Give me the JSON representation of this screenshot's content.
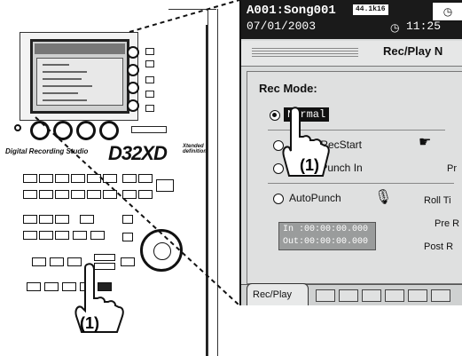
{
  "device": {
    "brand_small": "Digital Recording Studio",
    "brand_model": "D32XD",
    "brand_xtended_line1": "Xtended",
    "brand_xtended_line2": "definition"
  },
  "lcd": {
    "song_name": "A001:Song001",
    "sample_rate": "44.1k16",
    "date": "07/01/2003",
    "time": "11:25",
    "page_title": "Rec/Play N",
    "rec_mode_label": "Rec Mode:",
    "options": [
      {
        "label": "Normal",
        "selected": true
      },
      {
        "label": "/RecStart",
        "selected": false
      },
      {
        "label": "/Punch In",
        "selected": false
      },
      {
        "label": "AutoPunch",
        "selected": false
      }
    ],
    "punch_in": "In :00:00:00.000",
    "punch_out": "Out:00:00:00.000",
    "right_labels": [
      "Pr",
      "Roll Ti",
      "Pre R",
      "Post R"
    ],
    "tab_label": "Rec/Play"
  },
  "callouts": {
    "step_label_lcd": "(1)",
    "step_label_device": "(1)"
  }
}
